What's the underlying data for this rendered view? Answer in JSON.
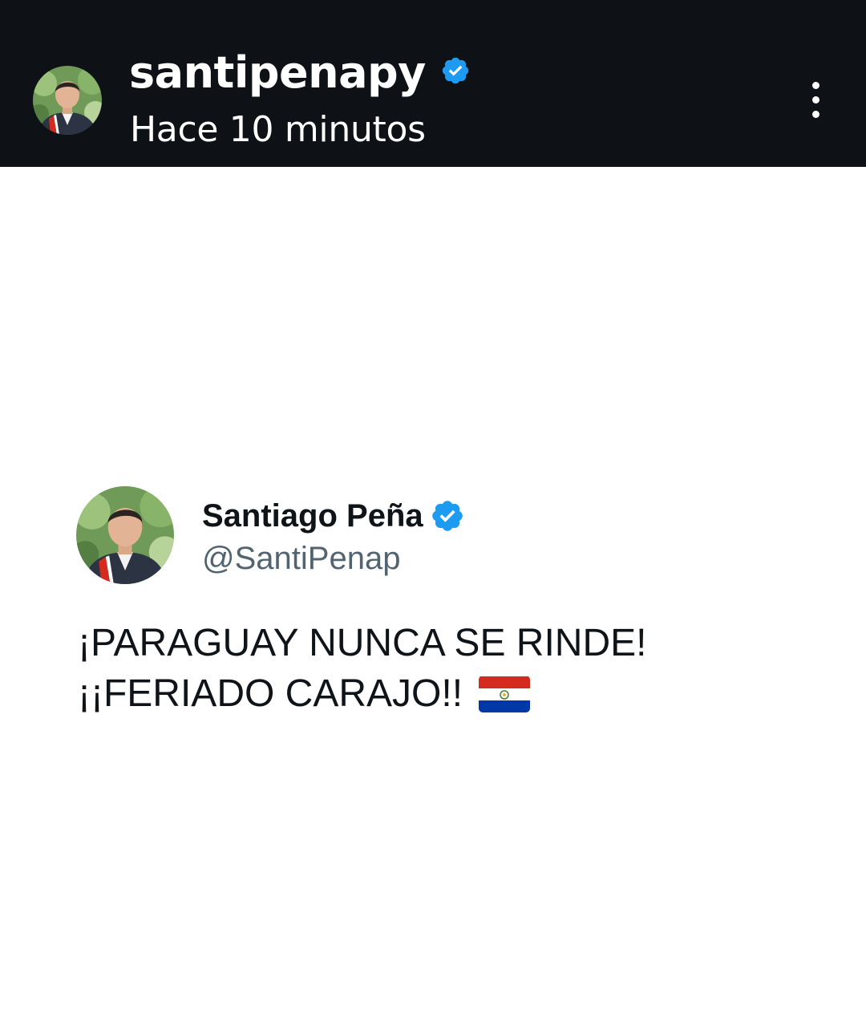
{
  "story": {
    "username": "santipenapy",
    "verified": true,
    "time": "Hace 10 minutos",
    "avatar_icon": "profile-photo-icon",
    "menu_icon": "more-vertical-icon"
  },
  "tweet": {
    "name": "Santiago Peña",
    "handle": "@SantiPenap",
    "verified": true,
    "avatar_icon": "profile-photo-icon",
    "lines": [
      "¡PARAGUAY NUNCA SE RINDE!",
      "¡¡FERIADO CARAJO!!"
    ],
    "emoji": "paraguay-flag-icon"
  },
  "colors": {
    "header_bg": "#0e1116",
    "verified_blue": "#1d9bf0",
    "tweet_text": "#0f1419",
    "handle_gray": "#536471",
    "flag_red": "#d52b1e",
    "flag_blue": "#0038a8"
  }
}
